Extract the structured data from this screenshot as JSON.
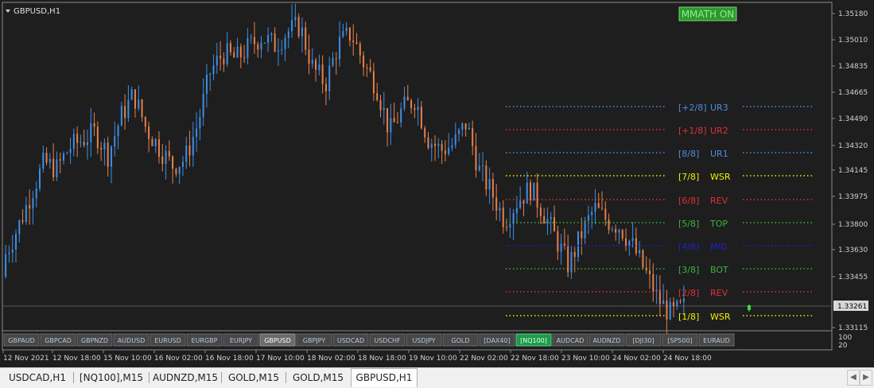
{
  "symbol_title": "GBPUSD,H1",
  "indicator_badge": "MMATH ON",
  "price_axis": {
    "ticks": [
      "1.35180",
      "1.35010",
      "1.34835",
      "1.34665",
      "1.34490",
      "1.34320",
      "1.34145",
      "1.33975",
      "1.33800",
      "1.33630",
      "1.33455",
      "1.33115"
    ],
    "current_price": "1.33261",
    "sub_ticks": [
      "100",
      "20"
    ]
  },
  "time_axis": [
    "12 Nov 2021",
    "12 Nov 18:00",
    "15 Nov 10:00",
    "16 Nov 02:00",
    "16 Nov 18:00",
    "17 Nov 10:00",
    "18 Nov 02:00",
    "18 Nov 18:00",
    "19 Nov 10:00",
    "22 Nov 02:00",
    "22 Nov 18:00",
    "23 Nov 10:00",
    "24 Nov 02:00",
    "24 Nov 18:00"
  ],
  "murrey_levels": [
    {
      "label": "[+2/8]",
      "name": "UR3",
      "color": "#4a8fdc"
    },
    {
      "label": "[+1/8]",
      "name": "UR2",
      "color": "#e0303a"
    },
    {
      "label": "[8/8]",
      "name": "UR1",
      "color": "#4a8fdc"
    },
    {
      "label": "[7/8]",
      "name": "WSR",
      "color": "#f0f000"
    },
    {
      "label": "[6/8]",
      "name": "REV",
      "color": "#e0303a"
    },
    {
      "label": "[5/8]",
      "name": "TOP",
      "color": "#3cb43c"
    },
    {
      "label": "[4/8]",
      "name": "MID",
      "color": "#2020c8"
    },
    {
      "label": "[3/8]",
      "name": "BOT",
      "color": "#3cb43c"
    },
    {
      "label": "[2/8]",
      "name": "REV",
      "color": "#e0303a"
    },
    {
      "label": "[1/8]",
      "name": "WSR",
      "color": "#f0f000"
    }
  ],
  "symbol_buttons": [
    {
      "label": "GBPAUD",
      "state": "normal"
    },
    {
      "label": "GBPCAD",
      "state": "normal"
    },
    {
      "label": "GBPNZD",
      "state": "normal"
    },
    {
      "label": "AUDUSD",
      "state": "normal"
    },
    {
      "label": "EURUSD",
      "state": "normal"
    },
    {
      "label": "EURGBP",
      "state": "normal"
    },
    {
      "label": "EURJPY",
      "state": "normal"
    },
    {
      "label": "GBPUSD",
      "state": "selected"
    },
    {
      "label": "GBPJPY",
      "state": "normal"
    },
    {
      "label": "USDCAD",
      "state": "normal"
    },
    {
      "label": "USDCHF",
      "state": "normal"
    },
    {
      "label": "USDJPY",
      "state": "normal"
    },
    {
      "label": "GOLD",
      "state": "normal"
    },
    {
      "label": "[DAX40]",
      "state": "normal"
    },
    {
      "label": "[NQ100]",
      "state": "green"
    },
    {
      "label": "AUDCAD",
      "state": "normal"
    },
    {
      "label": "AUDNZD",
      "state": "normal"
    },
    {
      "label": "[DJI30]",
      "state": "normal"
    },
    {
      "label": "[SP500]",
      "state": "normal"
    },
    {
      "label": "EURAUD",
      "state": "normal"
    }
  ],
  "bottom_tabs": [
    {
      "label": "USDCAD,H1",
      "active": false
    },
    {
      "label": "[NQ100],M15",
      "active": false
    },
    {
      "label": "AUDNZD,M15",
      "active": false
    },
    {
      "label": "GOLD,M15",
      "active": false
    },
    {
      "label": "GOLD,M15",
      "active": false
    },
    {
      "label": "GBPUSD,H1",
      "active": true
    }
  ],
  "colors": {
    "bull": "#3d8ee6",
    "bear": "#e8804a",
    "background": "#1e1e1e",
    "badge": "#2e9a2e"
  },
  "chart_data": {
    "type": "candlestick",
    "symbol": "GBPUSD",
    "timeframe": "H1",
    "y_range": [
      1.3307,
      1.3528
    ],
    "approx_closes": [
      1.336,
      1.3378,
      1.34,
      1.342,
      1.3416,
      1.343,
      1.3435,
      1.344,
      1.3425,
      1.345,
      1.3465,
      1.3442,
      1.343,
      1.3418,
      1.3422,
      1.3445,
      1.348,
      1.3492,
      1.3488,
      1.3496,
      1.3503,
      1.3497,
      1.3506,
      1.351,
      1.3482,
      1.3472,
      1.3498,
      1.3505,
      1.3485,
      1.347,
      1.344,
      1.3455,
      1.3462,
      1.3436,
      1.3428,
      1.3432,
      1.3446,
      1.3415,
      1.34,
      1.3382,
      1.3395,
      1.3403,
      1.3388,
      1.337,
      1.3352,
      1.3373,
      1.339,
      1.3382,
      1.3378,
      1.3365,
      1.3348,
      1.333,
      1.332,
      1.3325
    ]
  }
}
